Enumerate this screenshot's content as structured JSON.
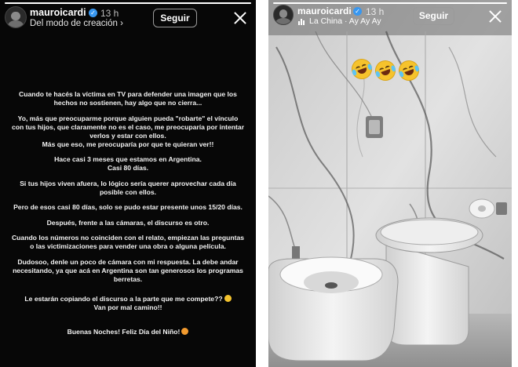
{
  "left_story": {
    "username": "mauroicardi",
    "time": "13 h",
    "subtitle": "Del modo de creación",
    "subtitle_arrow": "›",
    "follow_label": "Seguir",
    "verified_mark": "✓",
    "paragraphs": [
      "Cuando te hacés la víctima en TV para defender una imagen que los hechos no sostienen, hay algo que no cierra...",
      "Yo, más que preocuparme porque alguien pueda \"robarte\" el vínculo con tus hijos, que claramente no es el caso, me preocuparía por intentar verlos y estar con ellos.",
      "Más que eso, me preocuparía por que te quieran ver!!",
      "Hace casi 3 meses que estamos en Argentina.",
      "Casi 80 días.",
      "Si tus hijos viven afuera, lo lógico sería querer aprovechar cada día posible con ellos.",
      "Pero de esos casi 80 días, solo se pudo estar presente unos 15/20 días.",
      "Después, frente a las cámaras, el discurso es otro.",
      "Cuando los números no coinciden con el relato, empiezan las preguntas o las victimizaciones para vender una obra o alguna película.",
      "Dudosoo, denle un poco de cámara con mi respuesta. La debe andar necesitando, ya que acá en Argentina son tan generosos los programas berretas.",
      "Le estarán copiando el discurso a la parte que me compete??",
      "Van por mal camino!!",
      "Buenas Noches! Feliz Día del Niño!"
    ],
    "progress": 1.0
  },
  "right_story": {
    "username": "mauroicardi",
    "time": "13 h",
    "follow_label": "Seguir",
    "verified_mark": "✓",
    "music": "La China · Ay Ay Ay",
    "emoji": [
      "rolling-on-floor-laughing",
      "rolling-on-floor-laughing",
      "rolling-on-floor-laughing"
    ],
    "progress": 1.0
  }
}
